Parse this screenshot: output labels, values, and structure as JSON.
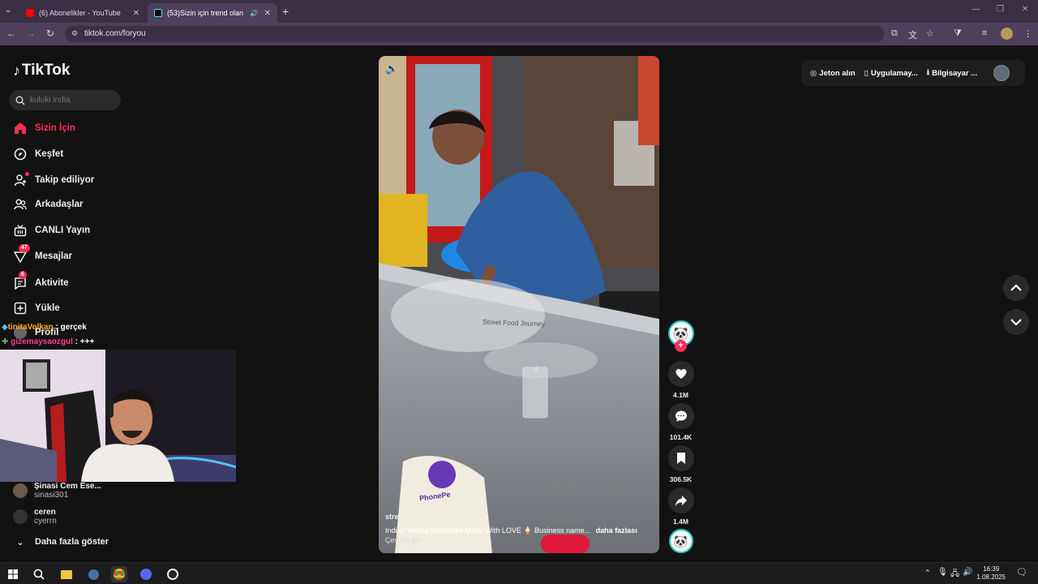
{
  "browser": {
    "tabs": [
      {
        "title": "(6) Abonelikler - YouTube",
        "active": false
      },
      {
        "title": "(53)Sizin için trend olan vide",
        "active": true
      }
    ],
    "new_tab": "+",
    "url": "tiktok.com/foryou"
  },
  "tiktok": {
    "logo": "TikTok",
    "search_placeholder": "kuluki india",
    "nav": [
      {
        "label": "Sizin İçin",
        "icon": "home-icon",
        "active": true
      },
      {
        "label": "Keşfet",
        "icon": "compass-icon"
      },
      {
        "label": "Takip ediliyor",
        "icon": "following-icon"
      },
      {
        "label": "Arkadaşlar",
        "icon": "friends-icon"
      },
      {
        "label": "CANLI Yayın",
        "icon": "live-icon"
      },
      {
        "label": "Mesajlar",
        "icon": "messages-icon",
        "badge": "47"
      },
      {
        "label": "Aktivite",
        "icon": "activity-icon",
        "badge": "6"
      },
      {
        "label": "Yükle",
        "icon": "upload-icon"
      },
      {
        "label": "Profil",
        "icon": "profile-icon"
      }
    ],
    "following": [
      {
        "name": "Şinasi  Cem  Ese...",
        "handle": "sinasi301"
      },
      {
        "name": "ceren",
        "handle": "cyerrn"
      }
    ],
    "show_more": "Daha fazla göster",
    "top_actions": {
      "coins": "Jeton alın",
      "app": "Uygulamay...",
      "pc": "Bilgisayar ..."
    },
    "video": {
      "watermark": "Street Food Journey",
      "author": "streetfoodjourney",
      "caption": "Indian Vanilla Milkshake Made With LOVE 🍦 Business name...",
      "more": "daha fazlası",
      "translate": "Çeviriyi gör",
      "phonepe": "PhonePe"
    },
    "rail": {
      "likes": "4.1M",
      "comments": "101.4K",
      "saves": "306.5K",
      "shares": "1.4M"
    }
  },
  "chat": [
    {
      "user": "tinitaVolkan",
      "text": " : gerçek"
    },
    {
      "user": "gizemaysaozgul",
      "text": " : +++"
    }
  ],
  "taskbar": {
    "time": "16:39",
    "date": "1.08.2025"
  }
}
